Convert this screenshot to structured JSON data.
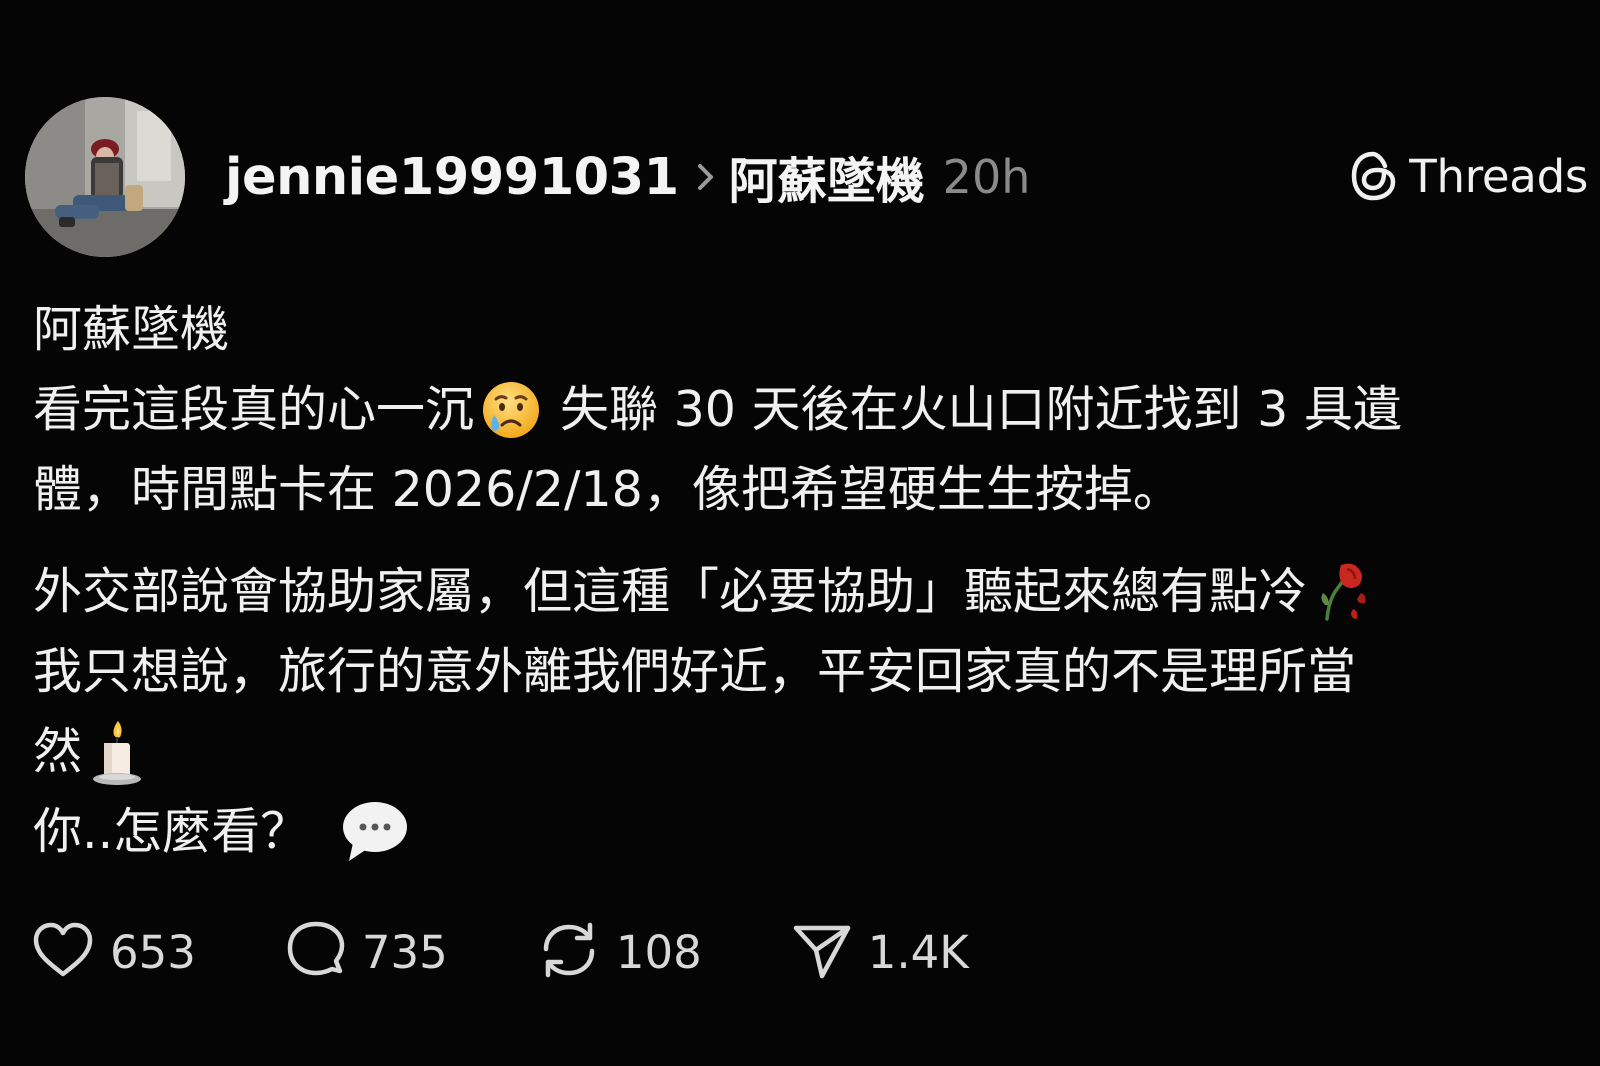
{
  "header": {
    "username": "jennie19991031",
    "community": "阿蘇墜機",
    "time_ago": "20h",
    "brand_name": "Threads"
  },
  "post": {
    "lines": [
      "阿蘇墜機",
      "看完這段真的心一沉",
      "失聯 30 天後在火山口附近找到 3 具遺",
      "體，時間點卡在 2026/2/18，像把希望硬生生按掉。",
      "外交部說會協助家屬，但這種「必要協助」聽起來總有點冷",
      "我只想說，旅行的意外離我們好近，平安回家真的不是理所當",
      "然",
      "你..怎麼看？"
    ]
  },
  "actions": {
    "likes": "653",
    "replies": "735",
    "reposts": "108",
    "shares": "1.4K"
  },
  "icons": {
    "emoji_sad": "sad-but-relieved-face-emoji",
    "emoji_rose": "wilted-rose-emoji",
    "emoji_candle": "candle-emoji",
    "emoji_speech": "speech-bubble-emoji"
  },
  "colors": {
    "background": "#050505",
    "text": "#f0f0f0",
    "muted": "#8a8a8a"
  }
}
